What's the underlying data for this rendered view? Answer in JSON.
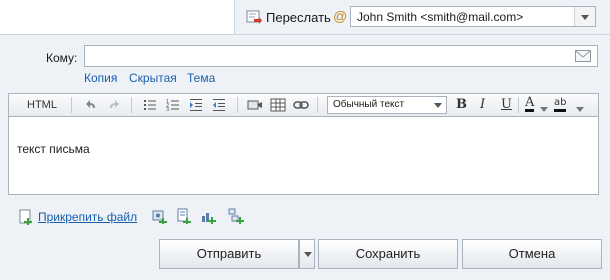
{
  "header": {
    "forward_label": "Переслать",
    "at_symbol": "@",
    "from_value": "John Smith <smith@mail.com>"
  },
  "recipients": {
    "to_label": "Кому:",
    "to_value": "",
    "links": {
      "copy": "Копия",
      "bcc": "Скрытая",
      "subject": "Тема"
    }
  },
  "toolbar": {
    "html_label": "HTML",
    "format_value": "Обычный текст",
    "bold": "B",
    "italic": "I",
    "underline": "U",
    "font_color": "A",
    "highlight": "ab"
  },
  "editor": {
    "text": "текст письма"
  },
  "attachments": {
    "attach_label": "Прикрепить файл"
  },
  "actions": {
    "send": "Отправить",
    "save": "Сохранить",
    "cancel": "Отмена"
  },
  "icons": {
    "forward": "forward-icon",
    "address_book": "address-book-icon",
    "undo": "undo-icon",
    "redo": "redo-icon",
    "bullet_list": "bullet-list-icon",
    "numbered_list": "numbered-list-icon",
    "indent": "indent-icon",
    "outdent": "outdent-icon",
    "video": "video-icon",
    "table": "table-icon",
    "link": "link-icon",
    "attach": "attach-file-icon"
  },
  "colors": {
    "accent_link": "#1a5fae",
    "panel_bg": "#eef2f6",
    "border": "#a9b4bf"
  }
}
